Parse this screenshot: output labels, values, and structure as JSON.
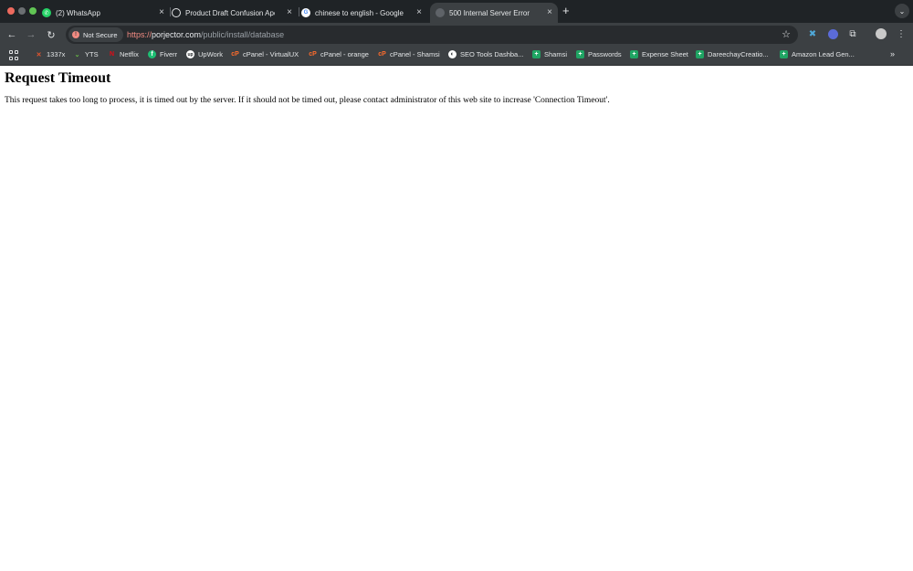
{
  "tabs": [
    {
      "title": "(2) WhatsApp",
      "icon": "whatsapp-icon",
      "active": false
    },
    {
      "title": "Product Draft Confusion Apo",
      "icon": "chatgpt-icon",
      "active": false
    },
    {
      "title": "chinese to english - Google S",
      "icon": "google-icon",
      "active": false
    },
    {
      "title": "500 Internal Server Error",
      "icon": "globe-icon",
      "active": true
    }
  ],
  "address_bar": {
    "security_label": "Not Secure",
    "url_scheme": "https://",
    "url_host": "porjector.com",
    "url_path": "/public/install/database"
  },
  "bookmarks": [
    {
      "label": "1337x",
      "icon": "x-icon",
      "color": "#e8552d"
    },
    {
      "label": "YTS",
      "icon": "yts-icon",
      "color": "#6ac045"
    },
    {
      "label": "Netflix",
      "icon": "netflix-icon",
      "color": "#e50914"
    },
    {
      "label": "Fiverr",
      "icon": "fiverr-icon",
      "color": "#1dbf73"
    },
    {
      "label": "UpWork",
      "icon": "upwork-icon",
      "color": "#ffffff"
    },
    {
      "label": "cPanel - VirtualUX",
      "icon": "cpanel-icon",
      "color": "#ff6c2c"
    },
    {
      "label": "cPanel - orange",
      "icon": "cpanel-icon",
      "color": "#ff6c2c"
    },
    {
      "label": "cPanel - Shamsi",
      "icon": "cpanel-icon",
      "color": "#ff6c2c"
    },
    {
      "label": "SEO Tools Dashba...",
      "icon": "globe-icon",
      "color": "#ffffff"
    },
    {
      "label": "Shamsi",
      "icon": "sheets-icon",
      "color": "#1fa463"
    },
    {
      "label": "Passwords",
      "icon": "sheets-icon",
      "color": "#1fa463"
    },
    {
      "label": "Expense Sheet",
      "icon": "sheets-icon",
      "color": "#1fa463"
    },
    {
      "label": "DareechayCreatio...",
      "icon": "sheets-icon",
      "color": "#1fa463"
    },
    {
      "label": "Amazon Lead Gen...",
      "icon": "sheets-icon",
      "color": "#1fa463"
    }
  ],
  "page": {
    "heading": "Request Timeout",
    "message": "This request takes too long to process, it is timed out by the server. If it should not be timed out, please contact administrator of this web site to increase 'Connection Timeout'."
  }
}
